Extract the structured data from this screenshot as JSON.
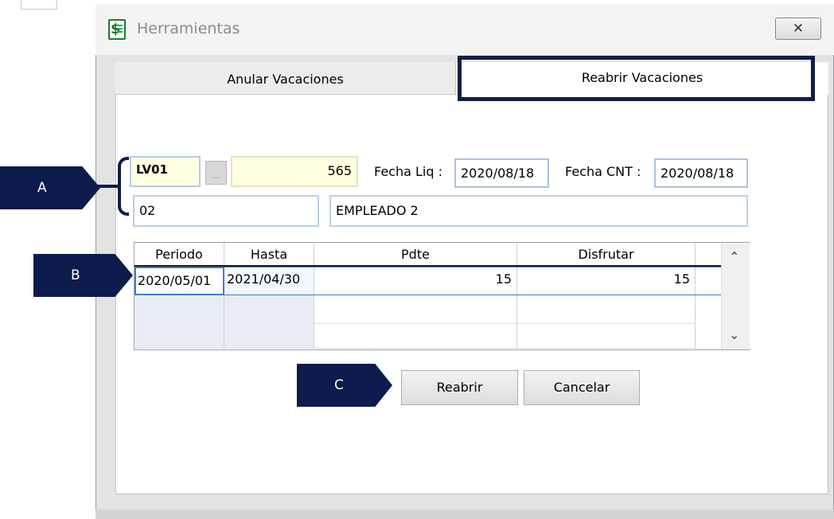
{
  "window": {
    "title": "Herramientas",
    "close_symbol": "✕"
  },
  "tabs": [
    {
      "label": "Anular Vacaciones",
      "active": false
    },
    {
      "label": "Reabrir Vacaciones",
      "active": true
    }
  ],
  "callouts": {
    "a": "A",
    "b": "B",
    "c": "C"
  },
  "form": {
    "code": "LV01",
    "lookup_button": "...",
    "number": "565",
    "fecha_liq_label": "Fecha Liq :",
    "fecha_liq": "2020/08/18",
    "fecha_cnt_label": "Fecha CNT :",
    "fecha_cnt": "2020/08/18",
    "sequence": "02",
    "employee": "EMPLEADO 2"
  },
  "grid": {
    "columns": [
      "Periodo",
      "Hasta",
      "Pdte",
      "Disfrutar"
    ],
    "rows": [
      [
        "2020/05/01",
        "2021/04/30",
        "15",
        "15"
      ]
    ]
  },
  "buttons": {
    "reabrir": "Reabrir",
    "cancelar": "Cancelar"
  },
  "colors": {
    "callout": "#0d1b4d",
    "highlight_field": "#ffffe1",
    "field_border": "#bcd0e6"
  }
}
